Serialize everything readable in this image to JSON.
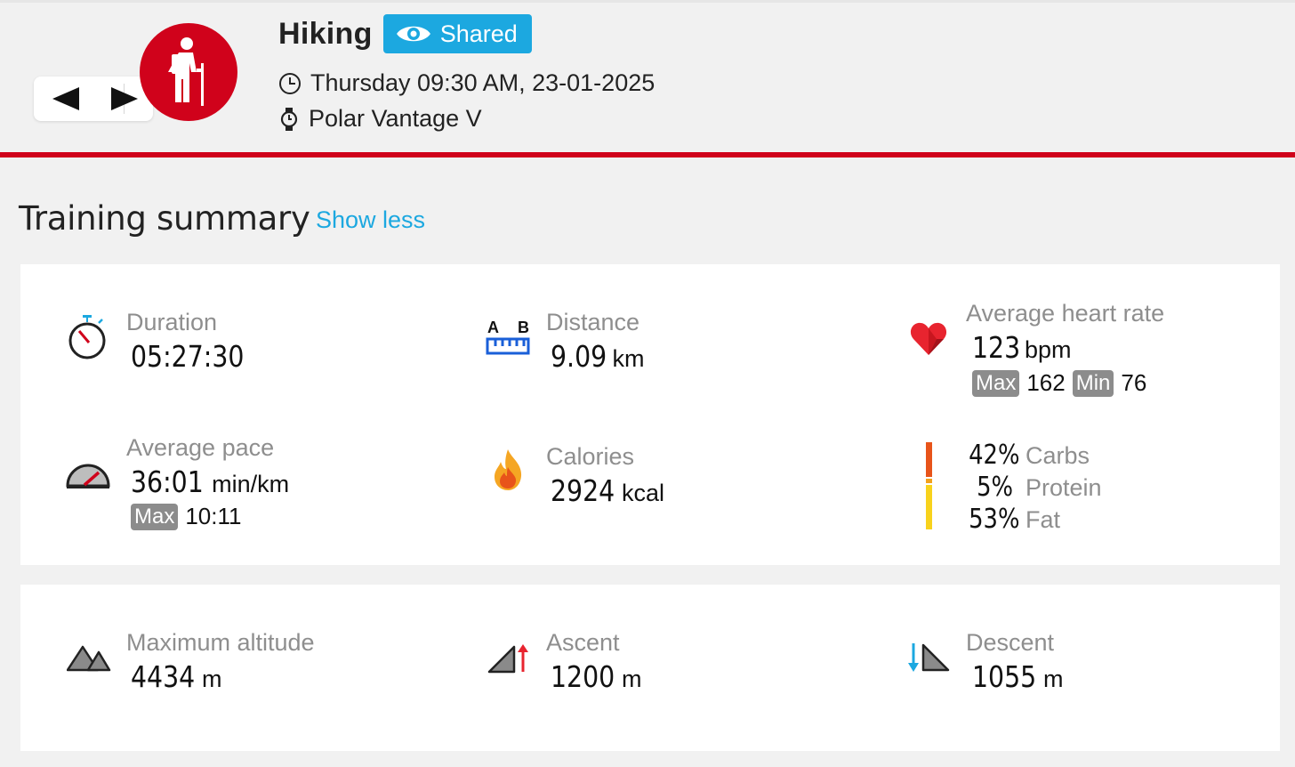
{
  "header": {
    "title": "Hiking",
    "shared_label": "Shared",
    "date": "Thursday 09:30 AM, 23-01-2025",
    "device": "Polar Vantage V",
    "accent_color": "#d0021b",
    "badge_color": "#1ca8e0",
    "icons": {
      "prev": "triangle-left-icon",
      "next": "triangle-right-icon",
      "sport": "hiker-icon",
      "shared": "eye-icon",
      "date": "clock-icon",
      "device": "watch-icon"
    }
  },
  "section": {
    "title": "Training summary",
    "toggle_label": "Show less"
  },
  "stats": {
    "duration": {
      "label": "Duration",
      "value": "05:27:30"
    },
    "distance": {
      "label": "Distance",
      "value": "9.09",
      "unit": "km"
    },
    "heart_rate": {
      "label": "Average heart rate",
      "value": "123",
      "unit": "bpm",
      "max_tag": "Max",
      "max": "162",
      "min_tag": "Min",
      "min": "76"
    },
    "pace": {
      "label": "Average pace",
      "value": "36:01",
      "unit": "min/km",
      "max_tag": "Max",
      "max": "10:11"
    },
    "calories": {
      "label": "Calories",
      "value": "2924",
      "unit": "kcal"
    },
    "macros": [
      {
        "pct": "42%",
        "name": "Carbs",
        "fraction": 0.42,
        "color": "#e8541a"
      },
      {
        "pct": "5%",
        "name": "Protein",
        "fraction": 0.05,
        "color": "#f3a21c"
      },
      {
        "pct": "53%",
        "name": "Fat",
        "fraction": 0.53,
        "color": "#f8d21c"
      }
    ],
    "max_altitude": {
      "label": "Maximum altitude",
      "value": "4434",
      "unit": "m"
    },
    "ascent": {
      "label": "Ascent",
      "value": "1200",
      "unit": "m"
    },
    "descent": {
      "label": "Descent",
      "value": "1055",
      "unit": "m"
    }
  }
}
